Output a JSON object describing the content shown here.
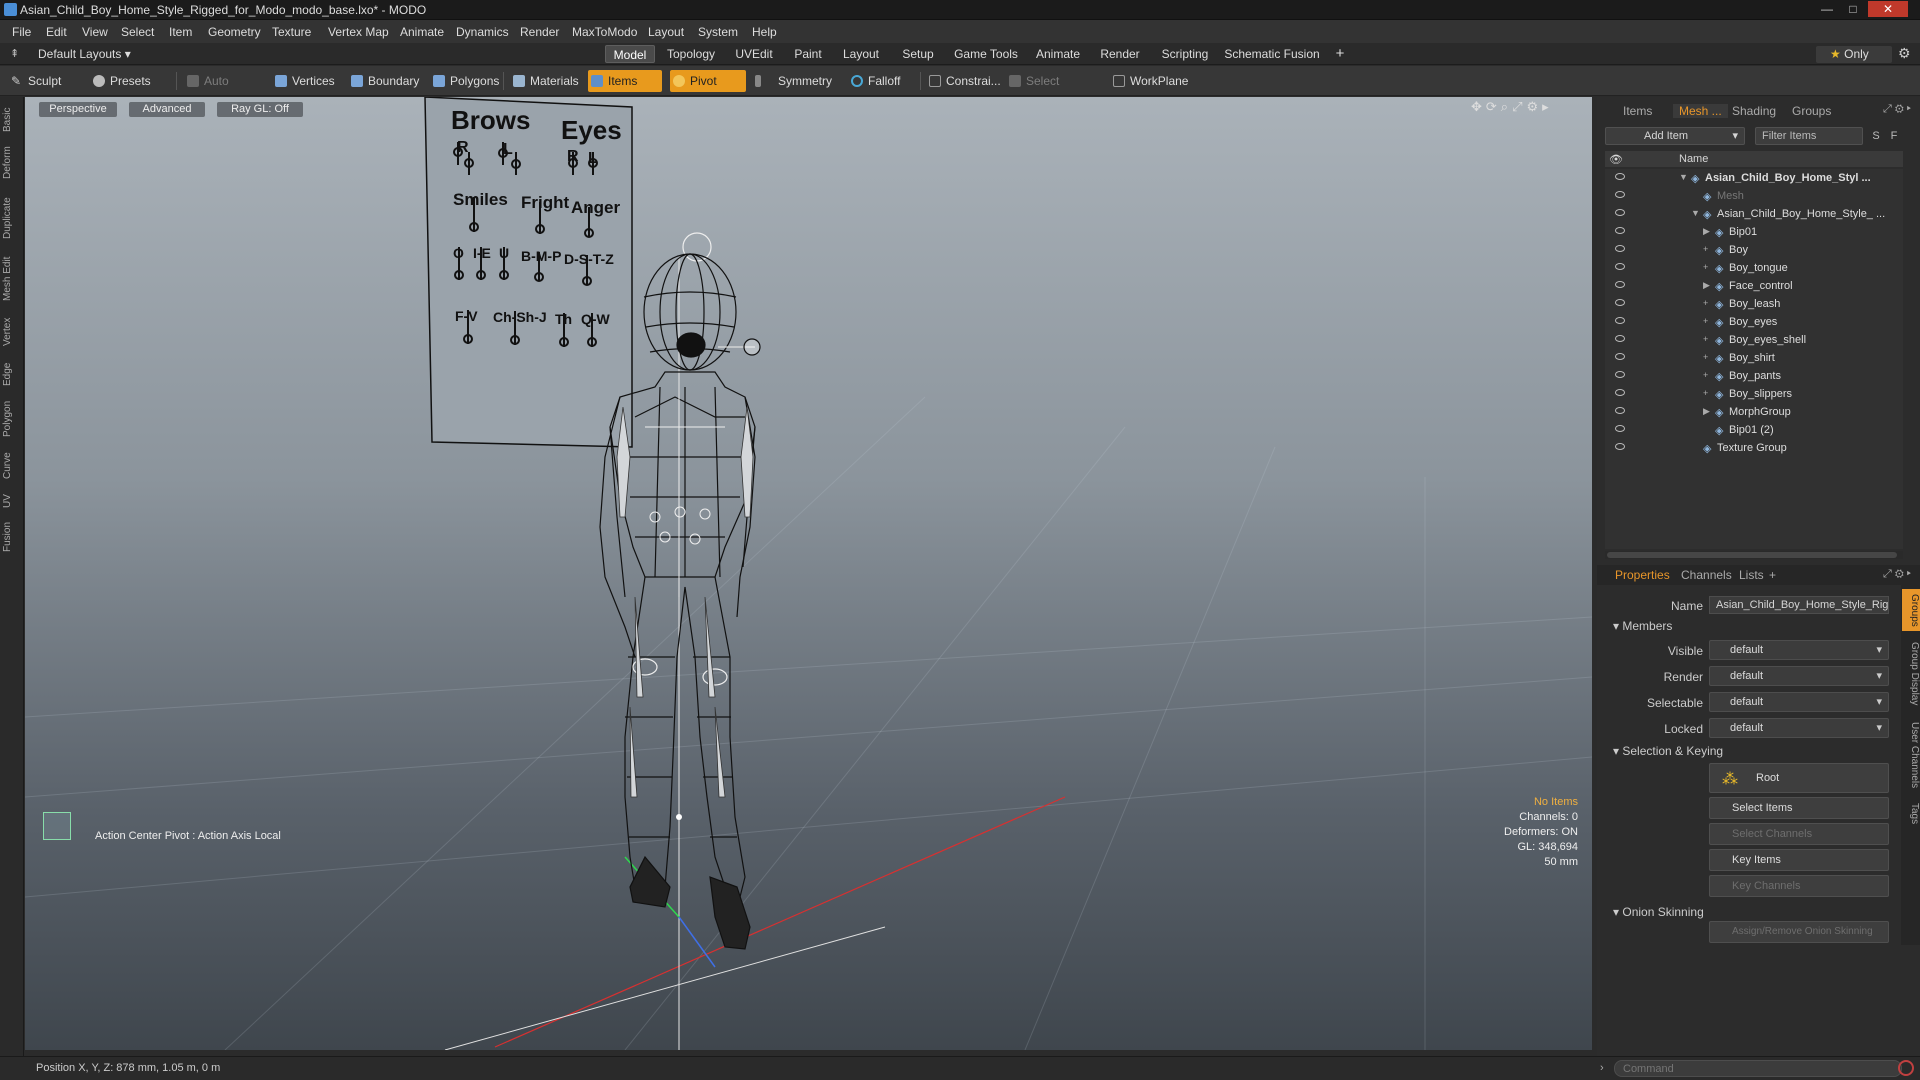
{
  "window": {
    "title": "Asian_Child_Boy_Home_Style_Rigged_for_Modo_modo_base.lxo* - MODO",
    "minimize": "—",
    "maximize": "□",
    "close": "✕"
  },
  "menu": [
    "File",
    "Edit",
    "View",
    "Select",
    "Item",
    "Geometry",
    "Texture",
    "Vertex Map",
    "Animate",
    "Dynamics",
    "Render",
    "MaxToModo",
    "Layout",
    "System",
    "Help"
  ],
  "layout_bar": {
    "default_layouts": "Default Layouts",
    "tabs": [
      "Model",
      "Topology",
      "UVEdit",
      "Paint",
      "Layout",
      "Setup",
      "Game Tools",
      "Animate",
      "Render",
      "Scripting",
      "Schematic Fusion"
    ],
    "active_tab": "Model",
    "add": "+",
    "only": "Only"
  },
  "toolbar": {
    "sculpt": "Sculpt",
    "presets": "Presets",
    "auto_select": "Auto Select",
    "vertices": "Vertices",
    "boundary": "Boundary",
    "polygons": "Polygons",
    "materials": "Materials",
    "items": "Items",
    "pivot": "Pivot",
    "symmetry": "Symmetry",
    "falloff": "Falloff",
    "constrain": "Constrai...",
    "select_through": "Select Through",
    "workplane": "WorkPlane"
  },
  "left_tabs": [
    "Basic",
    "Deform",
    "Duplicate",
    "Mesh Edit",
    "Vertex",
    "Edge",
    "Polygon",
    "Curve",
    "UV",
    "Fusion"
  ],
  "viewport": {
    "perspective": "Perspective",
    "advanced": "Advanced",
    "raygl": "Ray GL: Off",
    "action_center": "Action Center Pivot : Action Axis Local",
    "info": {
      "no_items": "No Items",
      "channels": "Channels: 0",
      "deformers": "Deformers: ON",
      "gl": "GL: 348,694",
      "mm": "50 mm"
    },
    "board": {
      "brows": "Brows",
      "eyes": "Eyes",
      "r1": "R",
      "l1": "L",
      "r2": "R",
      "l2": "L",
      "smiles": "Smiles",
      "fright": "Fright",
      "anger": "Anger",
      "o": "O",
      "ie": "I-E",
      "u": "U",
      "bmp": "B-M-P",
      "dstz": "D-S-T-Z",
      "fv": "F-V",
      "chshj": "Ch-Sh-J",
      "th": "Th",
      "qw": "Q-W"
    }
  },
  "items_panel": {
    "tabs": [
      "Items",
      "Mesh ...",
      "Shading",
      "Groups"
    ],
    "active_tab": "Mesh ...",
    "add_item": "Add Item",
    "filter": "Filter Items",
    "s": "S",
    "f": "F",
    "col_name": "Name",
    "rows": [
      {
        "label": "Asian_Child_Boy_Home_Styl ...",
        "indent": 0,
        "bold": true,
        "expander": "▼"
      },
      {
        "label": "Mesh",
        "indent": 1,
        "dim": true,
        "expander": ""
      },
      {
        "label": "Asian_Child_Boy_Home_Style_ ...",
        "indent": 1,
        "expander": "▼"
      },
      {
        "label": "Bip01",
        "indent": 2,
        "expander": "▶"
      },
      {
        "label": "Boy",
        "indent": 2,
        "expander": "+"
      },
      {
        "label": "Boy_tongue",
        "indent": 2,
        "expander": "+"
      },
      {
        "label": "Face_control",
        "indent": 2,
        "expander": "▶"
      },
      {
        "label": "Boy_leash",
        "indent": 2,
        "expander": "+"
      },
      {
        "label": "Boy_eyes",
        "indent": 2,
        "expander": "+"
      },
      {
        "label": "Boy_eyes_shell",
        "indent": 2,
        "expander": "+"
      },
      {
        "label": "Boy_shirt",
        "indent": 2,
        "expander": "+"
      },
      {
        "label": "Boy_pants",
        "indent": 2,
        "expander": "+"
      },
      {
        "label": "Boy_slippers",
        "indent": 2,
        "expander": "+"
      },
      {
        "label": "MorphGroup",
        "indent": 2,
        "expander": "▶"
      },
      {
        "label": "Bip01 (2)",
        "indent": 2,
        "expander": ""
      },
      {
        "label": "Texture Group",
        "indent": 1,
        "expander": ""
      }
    ]
  },
  "properties_panel": {
    "tabs": [
      "Properties",
      "Channels",
      "Lists",
      "+"
    ],
    "active_tab": "Properties",
    "name_label": "Name",
    "name_value": "Asian_Child_Boy_Home_Style_Rigg",
    "members": "Members",
    "visible_label": "Visible",
    "visible_value": "default",
    "render_label": "Render",
    "render_value": "default",
    "selectable_label": "Selectable",
    "selectable_value": "default",
    "locked_label": "Locked",
    "locked_value": "default",
    "selection_keying": "Selection & Keying",
    "root": "Root",
    "select_items": "Select Items",
    "select_channels": "Select Channels",
    "key_items": "Key Items",
    "key_channels": "Key Channels",
    "onion": "Onion Skinning",
    "assign_onion": "Assign/Remove Onion Skinning",
    "side_tabs": [
      "Groups",
      "Group Display",
      "User Channels",
      "Tags"
    ]
  },
  "status": {
    "position": "Position X, Y, Z:  878 mm, 1.05 m, 0 m",
    "command_placeholder": "Command"
  },
  "colors": {
    "accent": "#e8962a",
    "active_toolbar": "#e89a1d",
    "grid_red": "#d83030"
  }
}
